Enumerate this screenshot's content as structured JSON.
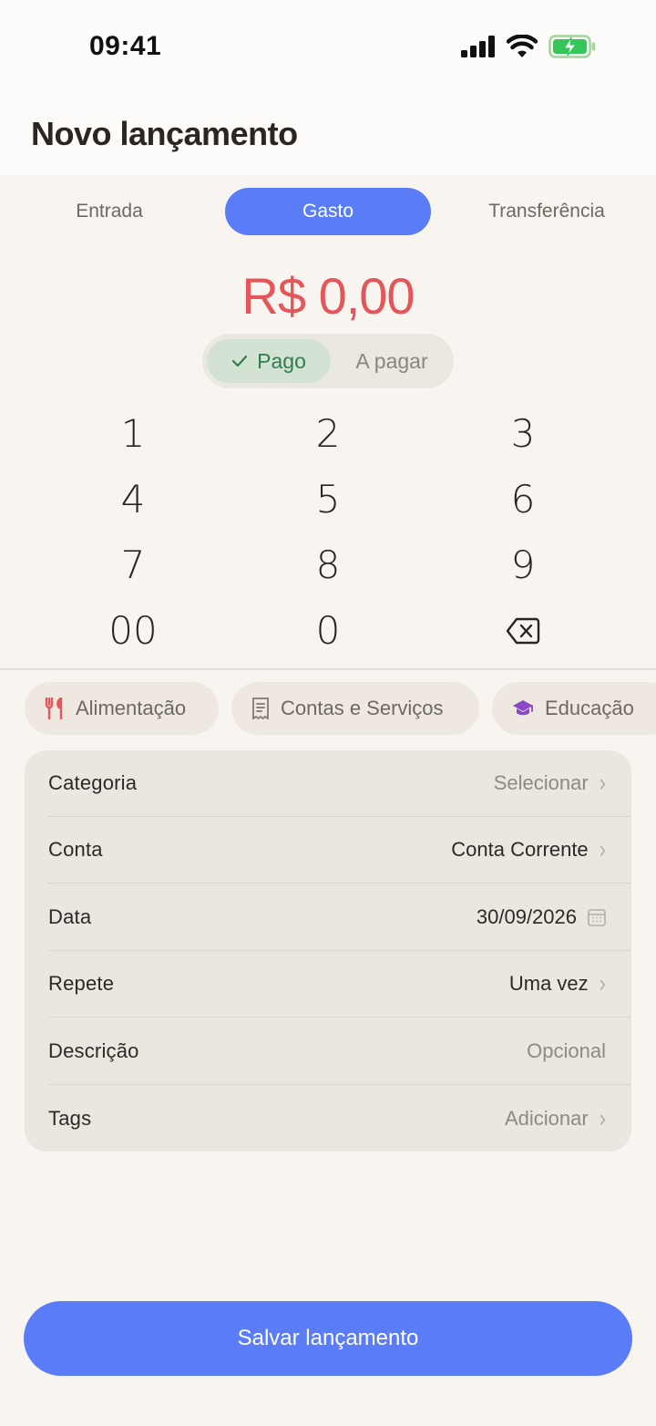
{
  "status_bar": {
    "time": "09:41"
  },
  "header": {
    "title": "Novo lançamento"
  },
  "type_tabs": [
    {
      "label": "Entrada",
      "selected": false
    },
    {
      "label": "Gasto",
      "selected": true
    },
    {
      "label": "Transferência",
      "selected": false
    }
  ],
  "amount": {
    "value": "R$ 0,00",
    "color": "#e3575a"
  },
  "paid_toggle": {
    "on_label": "Pago",
    "off_label": "A pagar",
    "selected": "Pago"
  },
  "keypad": {
    "keys": [
      "1",
      "2",
      "3",
      "4",
      "5",
      "6",
      "7",
      "8",
      "9",
      "00",
      "0"
    ],
    "backspace_icon": "backspace-icon"
  },
  "category_chips": [
    {
      "label": "Alimentação",
      "icon": "utensils-icon",
      "icon_color": "#e3575a"
    },
    {
      "label": "Contas e Serviços",
      "icon": "receipt-icon",
      "icon_color": "#8b857f"
    },
    {
      "label": "Educação",
      "icon": "graduation-cap-icon",
      "icon_color": "#8a48c6"
    }
  ],
  "form": {
    "rows": [
      {
        "label": "Categoria",
        "value": "Selecionar",
        "icon": "chevron-right-icon"
      },
      {
        "label": "Conta",
        "value": "Conta Corrente",
        "icon": "chevron-right-icon"
      },
      {
        "label": "Data",
        "value": "30/09/2026",
        "icon": "calendar-icon"
      },
      {
        "label": "Repete",
        "value": "Uma vez",
        "icon": "chevron-right-icon"
      },
      {
        "label": "Descrição",
        "value": "Opcional"
      },
      {
        "label": "Tags",
        "value": "Adicionar",
        "icon": "chevron-right-icon"
      }
    ]
  },
  "save_button": {
    "label": "Salvar lançamento"
  },
  "colors": {
    "accent": "#5a7cf6",
    "paid_green": "#2e7d4f",
    "background": "#f8f5f0"
  }
}
